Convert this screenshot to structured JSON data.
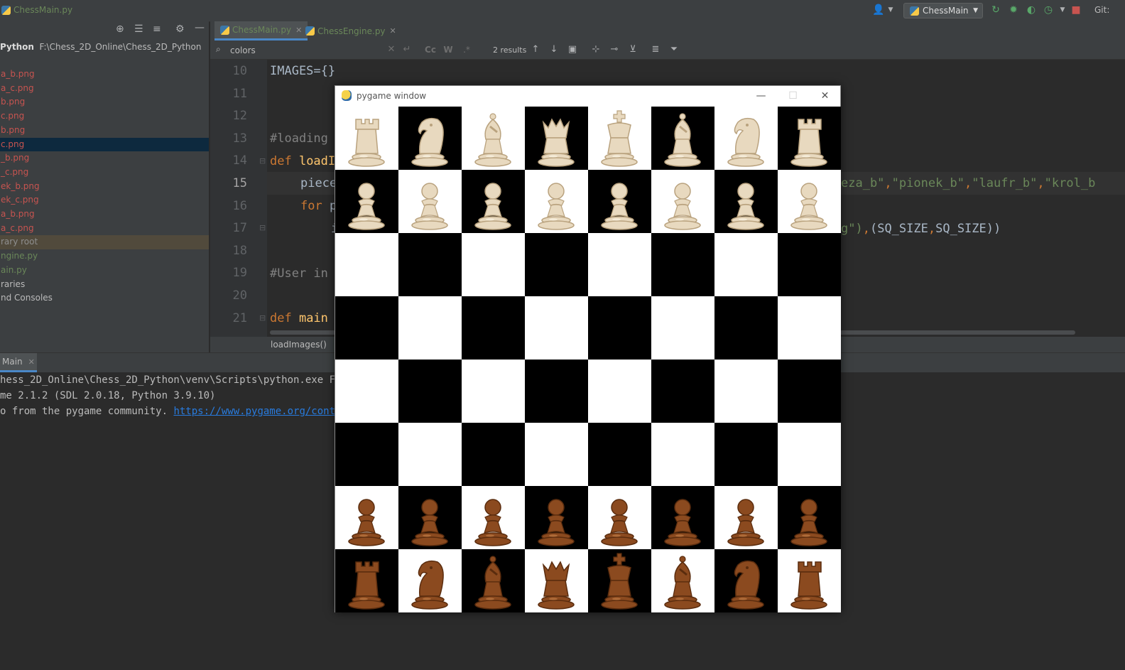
{
  "titlebar": {
    "file": "ChessMain.py",
    "run_config": "ChessMain",
    "git_label": "Git:"
  },
  "project": {
    "root_name": "Python",
    "root_path": "F:\\Chess_2D_Online\\Chess_2D_Python",
    "items": [
      {
        "label": "a_b.png",
        "color": "#c75450"
      },
      {
        "label": "a_c.png",
        "color": "#c75450"
      },
      {
        "label": "b.png",
        "color": "#c75450"
      },
      {
        "label": "c.png",
        "color": "#c75450"
      },
      {
        "label": "b.png",
        "color": "#c75450"
      },
      {
        "label": "c.png",
        "color": "#c75450",
        "selected": true
      },
      {
        "label": "_b.png",
        "color": "#c75450"
      },
      {
        "label": "_c.png",
        "color": "#c75450"
      },
      {
        "label": "ek_b.png",
        "color": "#c75450"
      },
      {
        "label": "ek_c.png",
        "color": "#c75450"
      },
      {
        "label": "a_b.png",
        "color": "#c75450"
      },
      {
        "label": "a_c.png",
        "color": "#c75450"
      },
      {
        "label": "rary root",
        "color": "#8f8f8f",
        "library": true
      },
      {
        "label": "ngine.py",
        "color": "#6a8759"
      },
      {
        "label": "ain.py",
        "color": "#6a8759"
      },
      {
        "label": "raries",
        "color": "#bbbbbb"
      },
      {
        "label": "nd Consoles",
        "color": "#bbbbbb"
      }
    ]
  },
  "editor": {
    "tabs": [
      {
        "label": "ChessMain.py",
        "active": true
      },
      {
        "label": "ChessEngine.py",
        "active": false
      }
    ],
    "search": {
      "value": "colors",
      "results": "2 results",
      "match_case": "Cc",
      "words": "W",
      "regex": ".*"
    },
    "lines": [
      {
        "num": "10"
      },
      {
        "num": "11"
      },
      {
        "num": "12"
      },
      {
        "num": "13"
      },
      {
        "num": "14"
      },
      {
        "num": "15",
        "current": true
      },
      {
        "num": "16"
      },
      {
        "num": "17"
      },
      {
        "num": "18"
      },
      {
        "num": "19"
      },
      {
        "num": "20"
      },
      {
        "num": "21"
      }
    ],
    "code": {
      "l10": "IMAGES={}",
      "l13": "#loading",
      "l14_kw": "def ",
      "l14_fn": "loadI",
      "l15": "piece",
      "l15_tail_a": "eza_b\"",
      "l15_tail_b": "\"pionek_b\"",
      "l15_tail_c": "\"laufr_b\"",
      "l15_tail_d": "\"krol_b",
      "l16_kw": "for ",
      "l16_rest": "p",
      "l17_a": "i",
      "l17_tail_str": "g\")",
      "l17_tail_rest": "(SQ_SIZE",
      "l17_tail_end": "SQ_SIZE))",
      "l19": "#User in",
      "l21_kw": "def ",
      "l21_fn": "main"
    },
    "breadcrumb": "loadImages()"
  },
  "run": {
    "tab_label": "Main",
    "console_lines": [
      "hess_2D_Online\\Chess_2D_Python\\venv\\Scripts\\python.exe F:/Ch",
      "me 2.1.2 (SDL 2.0.18, Python 3.9.10)"
    ],
    "console_line3_prefix": "o from the pygame community. ",
    "console_link": "https://www.pygame.org/contribu"
  },
  "pygame": {
    "title": "pygame window",
    "minimize": "—",
    "maximize": "☐",
    "close": "✕",
    "board": [
      [
        "wR",
        "wN",
        "wB",
        "wQ",
        "wK",
        "wB",
        "wN",
        "wR"
      ],
      [
        "wP",
        "wP",
        "wP",
        "wP",
        "wP",
        "wP",
        "wP",
        "wP"
      ],
      [
        "",
        "",
        "",
        "",
        "",
        "",
        "",
        ""
      ],
      [
        "",
        "",
        "",
        "",
        "",
        "",
        "",
        ""
      ],
      [
        "",
        "",
        "",
        "",
        "",
        "",
        "",
        ""
      ],
      [
        "",
        "",
        "",
        "",
        "",
        "",
        "",
        ""
      ],
      [
        "bP",
        "bP",
        "bP",
        "bP",
        "bP",
        "bP",
        "bP",
        "bP"
      ],
      [
        "bR",
        "bN",
        "bB",
        "bQ",
        "bK",
        "bB",
        "bN",
        "bR"
      ]
    ],
    "colors": {
      "light_square": "#ffffff",
      "dark_square": "#000000",
      "white_piece": "#e8d9bf",
      "black_piece": "#8b4a1f"
    }
  }
}
